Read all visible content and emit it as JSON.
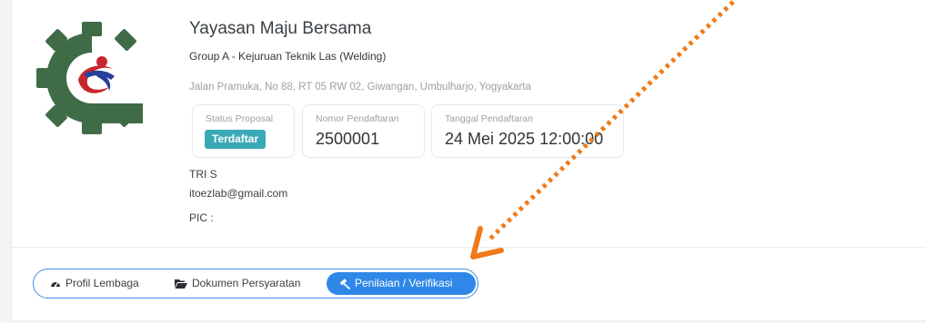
{
  "organization": {
    "name": "Yayasan Maju Bersama",
    "group": "Group A - Kejuruan Teknik Las (Welding)",
    "address": "Jalan Pramuka, No 88, RT 05 RW 02, Giwangan, Umbulharjo, Yogyakarta"
  },
  "info": {
    "status_label": "Status Proposal",
    "status_value": "Terdaftar",
    "nomor_label": "Nomor Pendaftaran",
    "nomor_value": "2500001",
    "tanggal_label": "Tanggal Pendaftaran",
    "tanggal_value": "24 Mei 2025 12:00:00"
  },
  "contact": {
    "name": "TRI S",
    "email": "itoezlab@gmail.com",
    "pic": "PIC :"
  },
  "tabs": [
    {
      "label": "Profil Lembaga",
      "icon": "gauge-icon"
    },
    {
      "label": "Dokumen Persyaratan",
      "icon": "folder-open-icon"
    },
    {
      "label": "Penilaian / Verifikasi",
      "icon": "gavel-icon",
      "active": true
    }
  ],
  "colors": {
    "badge": "#3aa9b6",
    "active_tab": "#2f88e8",
    "logo_gear": "#3f6b47",
    "logo_blue": "#2a3f9a",
    "logo_red": "#c8262d",
    "annotation_arrow": "#f07a1a"
  }
}
